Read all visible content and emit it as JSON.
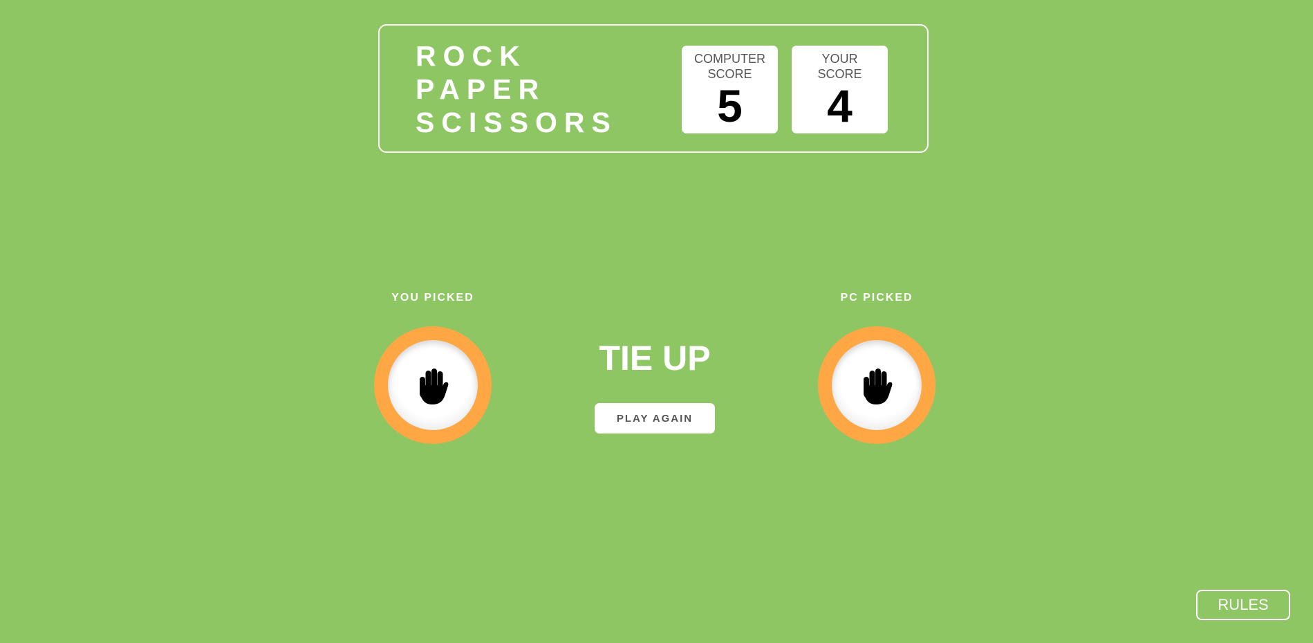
{
  "header": {
    "title_lines": [
      "ROCK",
      "PAPER",
      "SCISSORS"
    ],
    "computer_score": {
      "label_line1": "COMPUTER",
      "label_line2": "SCORE",
      "value": "5"
    },
    "your_score": {
      "label_line1": "YOUR",
      "label_line2": "SCORE",
      "value": "4"
    }
  },
  "game": {
    "you_label": "YOU PICKED",
    "pc_label": "PC PICKED",
    "you_choice_icon": "paper-hand-icon",
    "pc_choice_icon": "paper-hand-icon",
    "result": "TIE UP",
    "play_again_label": "PLAY AGAIN"
  },
  "rules": {
    "button_label": "RULES"
  },
  "colors": {
    "background": "#8dc662",
    "ring": "#ffa744",
    "text": "#ffffff"
  }
}
